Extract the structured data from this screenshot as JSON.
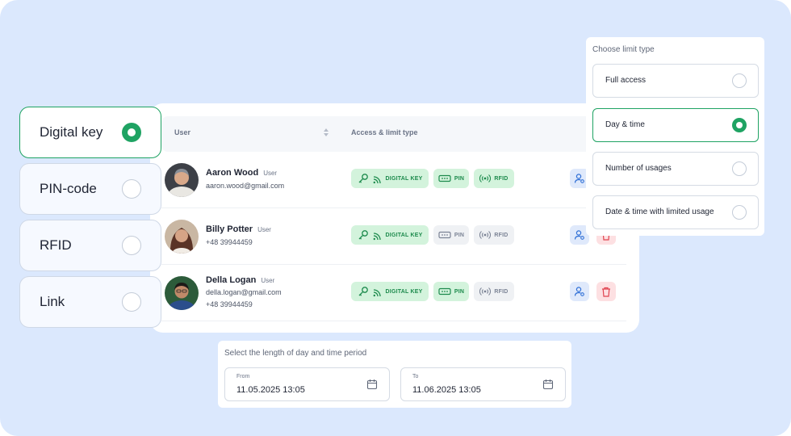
{
  "methods": [
    {
      "label": "Digital key",
      "selected": true
    },
    {
      "label": "PIN-code",
      "selected": false
    },
    {
      "label": "RFID",
      "selected": false
    },
    {
      "label": "Link",
      "selected": false
    }
  ],
  "table": {
    "columns": {
      "user": "User",
      "access": "Access & limit type"
    },
    "rows": [
      {
        "name": "Aaron Wood",
        "role": "User",
        "line1": "aaron.wood@gmail.com",
        "line2": "",
        "digital_key": "DIGITAL KEY",
        "pin": "PIN",
        "rfid": "RFID",
        "active": {
          "digital_key": true,
          "pin": true,
          "rfid": true
        }
      },
      {
        "name": "Billy Potter",
        "role": "User",
        "line1": "+48 39944459",
        "line2": "",
        "digital_key": "DIGITAL KEY",
        "pin": "PIN",
        "rfid": "RFID",
        "active": {
          "digital_key": true,
          "pin": false,
          "rfid": false
        }
      },
      {
        "name": "Della Logan",
        "role": "User",
        "line1": "della.logan@gmail.com",
        "line2": "+48 39944459",
        "digital_key": "DIGITAL KEY",
        "pin": "PIN",
        "rfid": "RFID",
        "active": {
          "digital_key": true,
          "pin": true,
          "rfid": false
        }
      }
    ]
  },
  "limit": {
    "title": "Choose limit type",
    "options": [
      {
        "label": "Full access",
        "selected": false
      },
      {
        "label": "Day & time",
        "selected": true
      },
      {
        "label": "Number of usages",
        "selected": false
      },
      {
        "label": "Date & time with limited usage",
        "selected": false
      }
    ]
  },
  "period": {
    "title": "Select the length of day and time period",
    "from": {
      "label": "From",
      "value": "11.05.2025  13:05"
    },
    "to": {
      "label": "To",
      "value": "11.06.2025  13:05"
    }
  },
  "colors": {
    "accent": "#1fa363",
    "background": "#dbe8fd",
    "badge_active_bg": "#d3f3dc",
    "badge_active_text": "#1c8a4c",
    "delete_bg": "#fde0e2",
    "delete_icon": "#e0434f",
    "user_action_icon": "#2f6fd6"
  },
  "icons": [
    "key-icon",
    "wifi-signal-icon",
    "pin-keypad-icon",
    "rfid-icon",
    "manage-user-icon",
    "trash-icon",
    "calendar-icon",
    "sort-icon"
  ]
}
